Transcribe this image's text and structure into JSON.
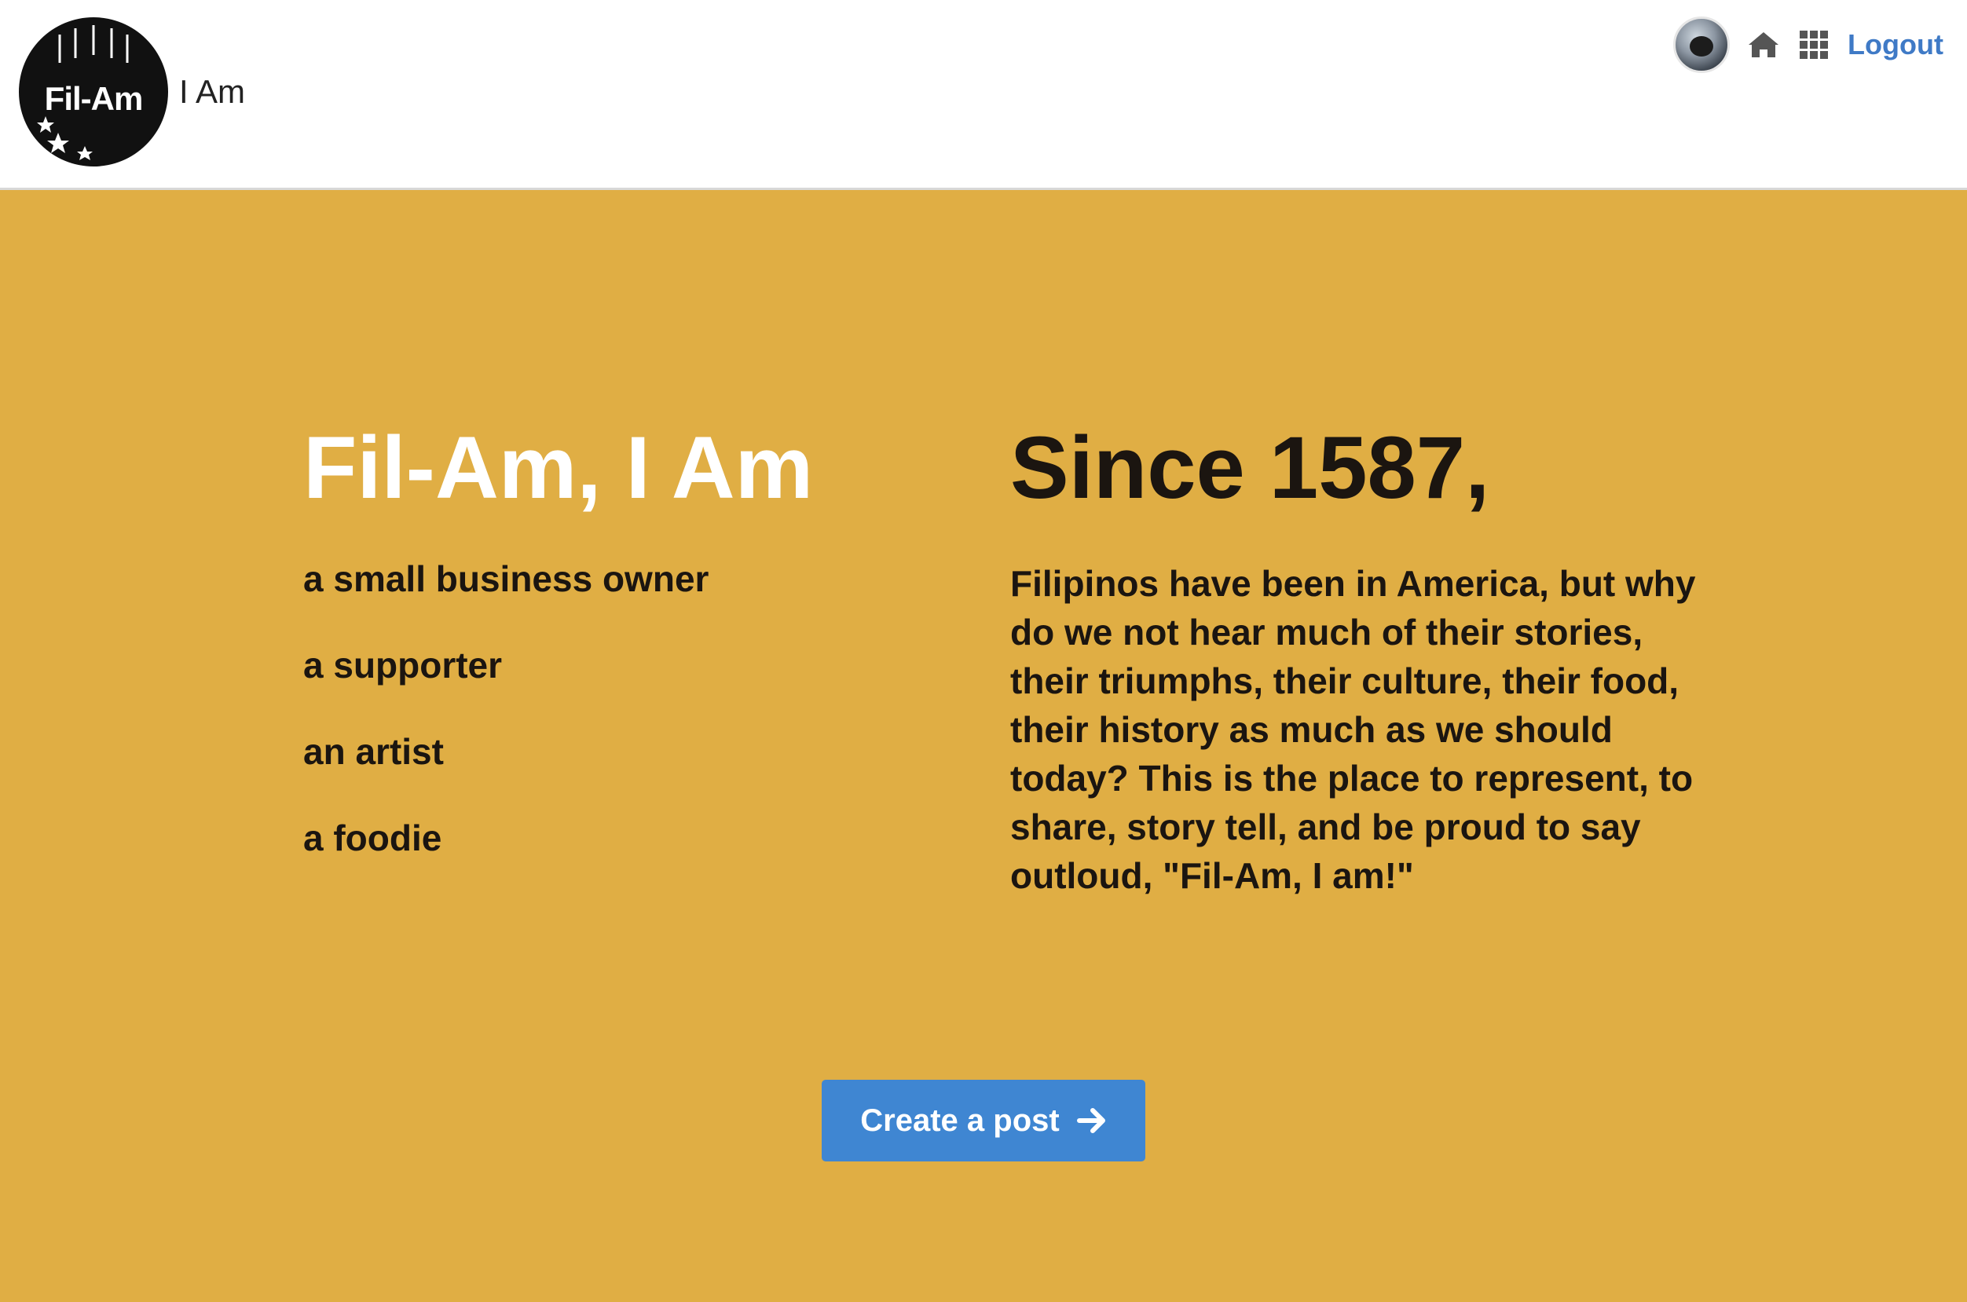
{
  "header": {
    "logo_mark_text": "Fil-Am",
    "logo_suffix_text": "I Am",
    "nav": {
      "home_icon": "home-icon",
      "apps_icon": "grid-icon",
      "logout_label": "Logout"
    }
  },
  "hero": {
    "title": "Fil-Am, I Am",
    "roles": [
      "a small business owner",
      "a supporter",
      "an artist",
      "a foodie"
    ],
    "since_title": "Since 1587,",
    "description": "Filipinos have been in America, but why do we not hear much of their stories, their triumphs, their culture, their food, their history as much as we should today? This is the place to represent, to share, story tell, and be proud to say outloud, \"Fil-Am, I am!\"",
    "cta_label": "Create a post",
    "cta_icon": "arrow-right-icon"
  },
  "colors": {
    "hero_background": "#e0ae44",
    "accent_blue": "#3f86d2",
    "link_blue": "#3f7ac6",
    "dark_text": "#1b1510"
  }
}
